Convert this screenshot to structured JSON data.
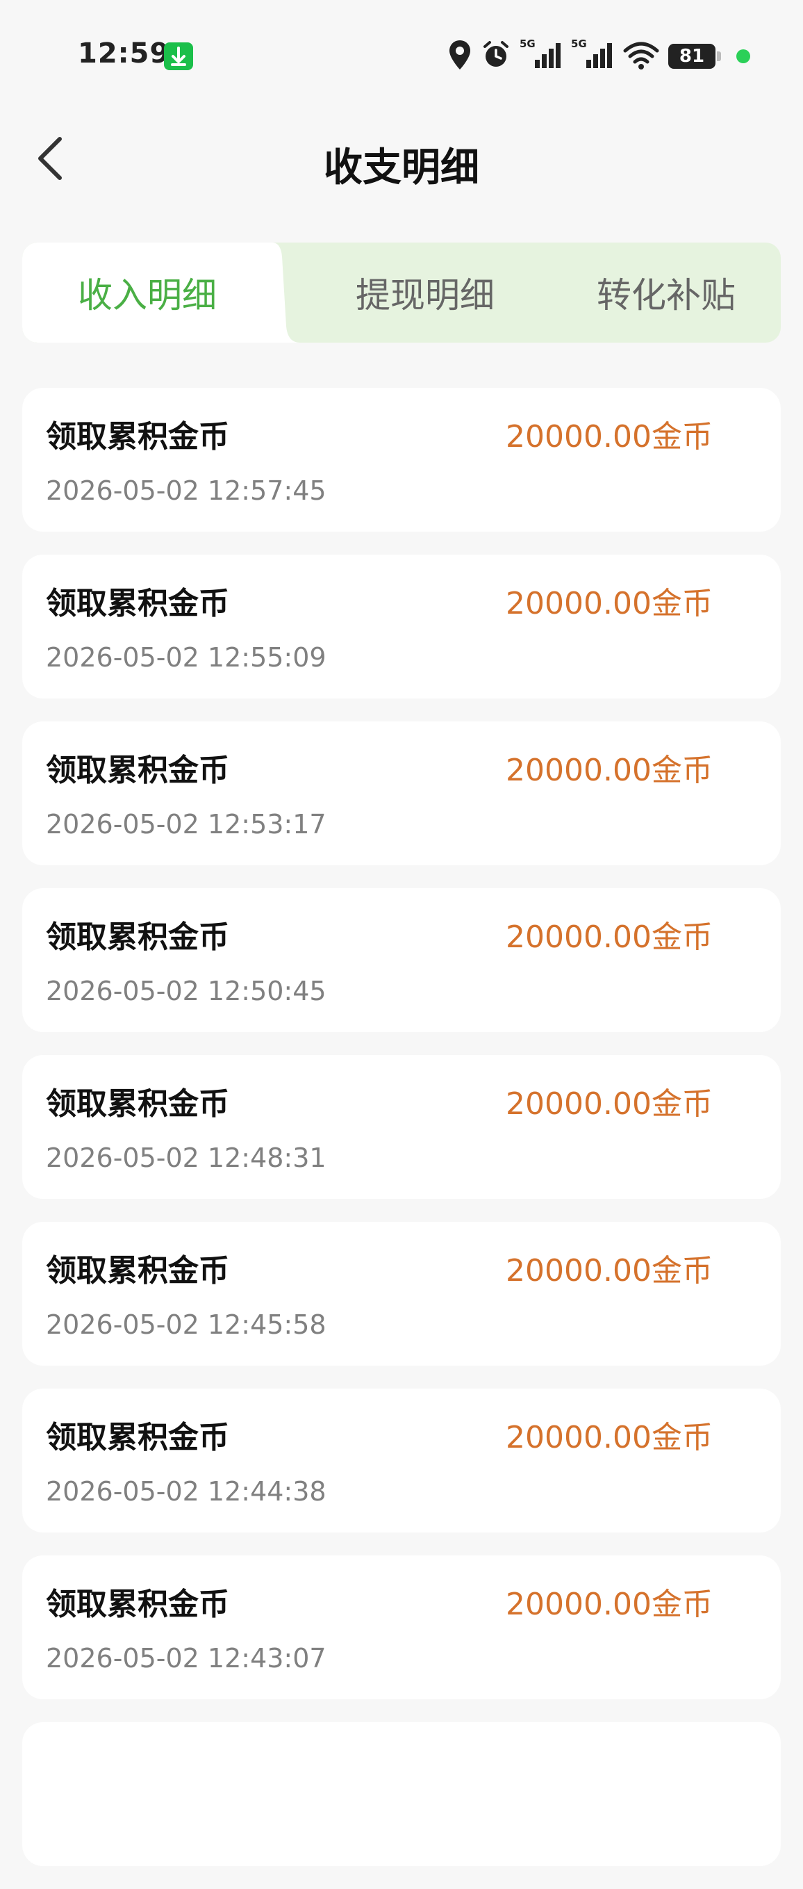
{
  "status_bar": {
    "time": "12:59",
    "network_1": "5G",
    "network_2": "5G",
    "battery": "81",
    "colors": {
      "download_badge": "#1bbf4a",
      "active_dot": "#2bd058"
    }
  },
  "header": {
    "title": "收支明细",
    "back_icon": "chevron-left-icon"
  },
  "tabs": [
    {
      "label": "收入明细",
      "active": true
    },
    {
      "label": "提现明细",
      "active": false
    },
    {
      "label": "转化补贴",
      "active": false
    }
  ],
  "records": [
    {
      "title": "领取累积金币",
      "amount": "20000.00金币",
      "time": "2026-05-02 12:57:45"
    },
    {
      "title": "领取累积金币",
      "amount": "20000.00金币",
      "time": "2026-05-02 12:55:09"
    },
    {
      "title": "领取累积金币",
      "amount": "20000.00金币",
      "time": "2026-05-02 12:53:17"
    },
    {
      "title": "领取累积金币",
      "amount": "20000.00金币",
      "time": "2026-05-02 12:50:45"
    },
    {
      "title": "领取累积金币",
      "amount": "20000.00金币",
      "time": "2026-05-02 12:48:31"
    },
    {
      "title": "领取累积金币",
      "amount": "20000.00金币",
      "time": "2026-05-02 12:45:58"
    },
    {
      "title": "领取累积金币",
      "amount": "20000.00金币",
      "time": "2026-05-02 12:44:38"
    },
    {
      "title": "领取累积金币",
      "amount": "20000.00金币",
      "time": "2026-05-02 12:43:07"
    }
  ],
  "theme": {
    "accent_green": "#4aaf45",
    "tab_bg": "#e6f3df",
    "amount_orange": "#d5722c",
    "page_bg": "#f7f7f7"
  }
}
